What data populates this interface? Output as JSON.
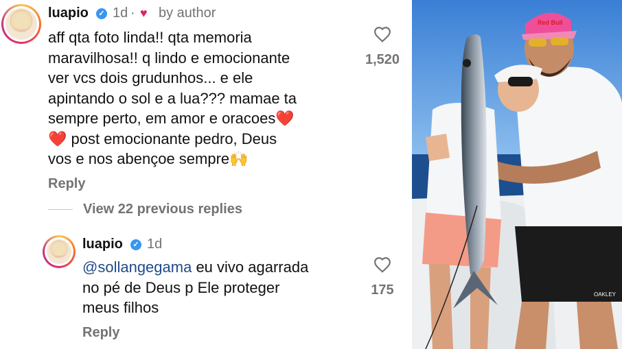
{
  "comment1": {
    "username": "luapio",
    "time": "1d",
    "liked_by": "by author",
    "text_lines": [
      "aff qta foto linda!! qta memoria",
      "maravilhosa!! q lindo e emocionante",
      "ver vcs dois grudunhos... e ele",
      "apintando o sol e a lua??? mamae ta",
      "sempre perto, em amor e oracoes❤️",
      "❤️ post emocionante pedro, Deus",
      "vos e nos abençoe sempre🙌"
    ],
    "like_count": "1,520",
    "reply_label": "Reply"
  },
  "view_previous": "View 22 previous replies",
  "comment2": {
    "username": "luapio",
    "time": "1d",
    "mention": "@sollangegama",
    "text_first": " eu vivo agarrada",
    "text_lines": [
      "no pé de Deus p Ele proteger",
      "meus filhos"
    ],
    "like_count": "175",
    "reply_label": "Reply"
  },
  "photo": {
    "cap_text": "Red Bull",
    "shorts_brand": "OAKLEY"
  },
  "colors": {
    "verified": "#3897f0",
    "meta_gray": "#737373",
    "mention_blue": "#1f4a8a",
    "heart_red": "#e0245e"
  }
}
